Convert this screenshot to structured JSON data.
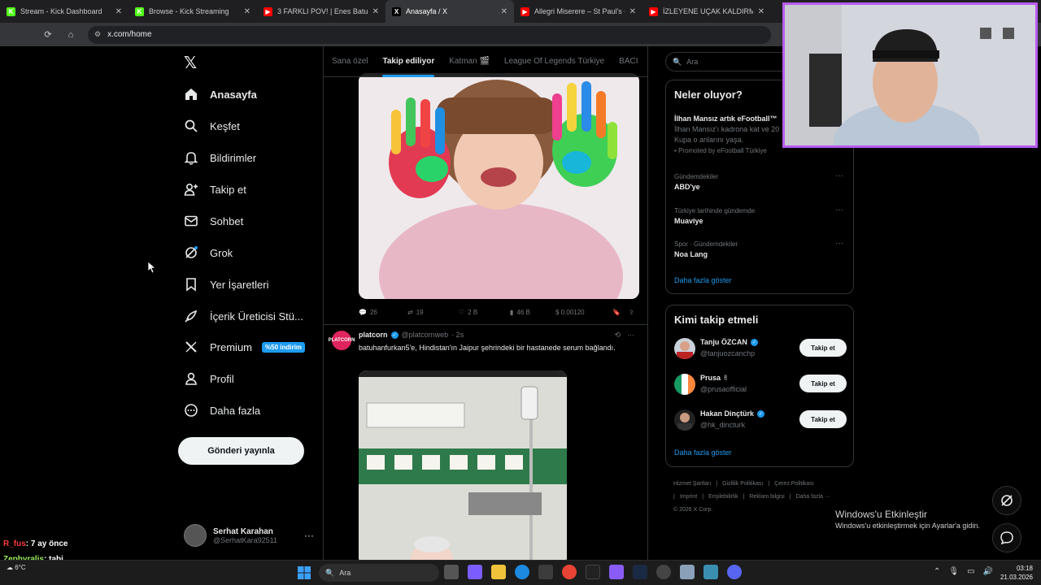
{
  "browser": {
    "tabs": [
      {
        "label": "Stream - Kick Dashboard",
        "fav_color": "#53fc18",
        "fav_glyph": "K",
        "active": false
      },
      {
        "label": "Browse - Kick Streaming",
        "fav_color": "#53fc18",
        "fav_glyph": "K",
        "active": false
      },
      {
        "label": "3 FARKLI POV! | Enes Batur: Ha...",
        "fav_color": "#ff0000",
        "fav_glyph": "▶",
        "active": false
      },
      {
        "label": "Anasayfa / X",
        "fav_color": "#000000",
        "fav_glyph": "X",
        "active": true
      },
      {
        "label": "Allegri Miserere – St Paul's Cath...",
        "fav_color": "#ff0000",
        "fav_glyph": "▶",
        "active": false
      },
      {
        "label": "İZLEYENE UÇAK KALDIRMAYI Ö...",
        "fav_color": "#ff0000",
        "fav_glyph": "▶",
        "active": false
      }
    ],
    "url": "x.com/home"
  },
  "nav": {
    "items": [
      {
        "label": "Anasayfa",
        "icon": "home-icon"
      },
      {
        "label": "Keşfet",
        "icon": "search-icon"
      },
      {
        "label": "Bildirimler",
        "icon": "bell-icon"
      },
      {
        "label": "Takip et",
        "icon": "person-add-icon"
      },
      {
        "label": "Sohbet",
        "icon": "mail-icon"
      },
      {
        "label": "Grok",
        "icon": "grok-icon"
      },
      {
        "label": "Yer İşaretleri",
        "icon": "bookmark-icon"
      },
      {
        "label": "İçerik Üreticisi Stü...",
        "icon": "rocket-icon"
      },
      {
        "label": "Premium",
        "icon": "x-icon"
      },
      {
        "label": "Profil",
        "icon": "person-icon"
      },
      {
        "label": "Daha fazla",
        "icon": "more-circle-icon"
      }
    ],
    "premium_badge": "%50 indirim",
    "post_button": "Gönderi yayınla",
    "account": {
      "name": "Serhat Karahan",
      "handle": "@SerhatKara92511",
      "more": "···"
    }
  },
  "feed": {
    "tabs": [
      "Sana özel",
      "Takip ediliyor",
      "Katman 🎬",
      "League Of Legends Türkiye",
      "BACI"
    ],
    "active_tab": "Takip ediliyor",
    "post1_actions": {
      "replies": "26",
      "reposts": "19",
      "likes": "2 B",
      "views": "46 B",
      "tip": "$ 0.00120"
    },
    "post2": {
      "name": "platcorn",
      "handle": "@platcornweb",
      "time": "· 2s",
      "text": "batuhanfurkan5'e, Hindistan'ın Jaipur şehrindeki bir hastanede serum bağlandı.",
      "avatar_label": "PLATCORN"
    }
  },
  "sidebar": {
    "search_placeholder": "Ara",
    "trends_title": "Neler oluyor?",
    "promo": {
      "title": "İlhan Mansız artık eFootball™",
      "body": "İlhan Mansız'ı kadrona kat ve 20 Kupa o anlarını yaşa.",
      "by": "Promoted by eFootball Türkiye"
    },
    "trends": [
      {
        "meta": "Gündemdekiler",
        "title": "ABD'ye"
      },
      {
        "meta": "Türkiye tarihinde gündemde",
        "title": "Muaviye"
      },
      {
        "meta": "Spor · Gündemdekiler",
        "title": "Noa Lang"
      }
    ],
    "show_more": "Daha fazla göster",
    "who_title": "Kimi takip etmeli",
    "suggestions": [
      {
        "name": "Tanju ÖZCAN",
        "handle": "@tanjuozcanchp",
        "verified": true,
        "button": "Takip et"
      },
      {
        "name": "Prusa ✌",
        "handle": "@prusaofficial",
        "verified": false,
        "button": "Takip et"
      },
      {
        "name": "Hakan Dinçtürk",
        "handle": "@hk_dincturk",
        "verified": true,
        "button": "Takip et"
      }
    ],
    "footer": [
      "Hizmet Şartları",
      "|",
      "Gizlilik Politikası",
      "|",
      "Çerez Politikası",
      "|",
      "Imprint",
      "|",
      "Erişilebilirlik",
      "|",
      "Reklam bilgisi",
      "|",
      "Daha fazla ···",
      "© 2026 X Corp."
    ]
  },
  "overlay": {
    "windows_activate_title": "Windows'u Etkinleştir",
    "windows_activate_sub": "Windows'u etkinleştirmek için Ayarlar'a gidin.",
    "chat": [
      {
        "user": "R_fus",
        "msg": ": 7 ay önce",
        "color": "#ff3b3b"
      },
      {
        "user": "Zephyralis",
        "msg": ": tabi",
        "color": "#9cf25f"
      }
    ]
  },
  "taskbar": {
    "weather": "6°C",
    "search": "Ara",
    "time": "03:18",
    "date": "21.03.2026"
  }
}
